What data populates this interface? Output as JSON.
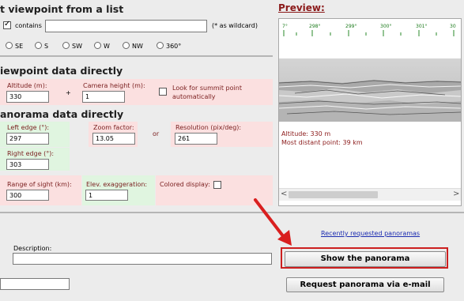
{
  "sections": {
    "list_title": "t viewpoint from a list",
    "direct_title": "iewpoint data directly",
    "panorama_title": "anorama data directly"
  },
  "list": {
    "contains_label": "contains",
    "search_value": "",
    "wildcard_hint": "(* as wildcard)",
    "directions": [
      "SE",
      "S",
      "SW",
      "W",
      "NW",
      "360°"
    ]
  },
  "viewpoint": {
    "altitude_label": "Altitude (m):",
    "altitude_value": "330",
    "plus": "+",
    "camera_label": "Camera height (m):",
    "camera_value": "1",
    "summit_label_1": "Look for summit point",
    "summit_label_2": "automatically"
  },
  "panorama": {
    "left_label": "Left edge (°):",
    "left_value": "297",
    "zoom_label": "Zoom factor:",
    "zoom_value": "13.05",
    "or": "or",
    "resolution_label": "Resolution (pix/deg):",
    "resolution_value": "261",
    "right_label": "Right edge (°):",
    "right_value": "303",
    "range_label": "Range of sight (km):",
    "range_value": "300",
    "elev_label": "Elev. exaggeration:",
    "elev_value": "1",
    "colored_label": "Colored display:"
  },
  "preview": {
    "title": "Preview:",
    "ticks": [
      "7°",
      "298°",
      "299°",
      "300°",
      "301°",
      "30"
    ],
    "altitude_text": "Altitude: 330 m",
    "distant_text": "Most distant point: 39 km"
  },
  "bottom": {
    "recent_link": "Recently requested panoramas",
    "description_label": "Description:",
    "description_value": "",
    "email_value": "",
    "show_button": "Show the panorama",
    "email_button": "Request panorama via e-mail"
  },
  "colors": {
    "highlight": "#cc1f1f",
    "label": "#7a1e1e",
    "link": "#1a2bb0"
  }
}
